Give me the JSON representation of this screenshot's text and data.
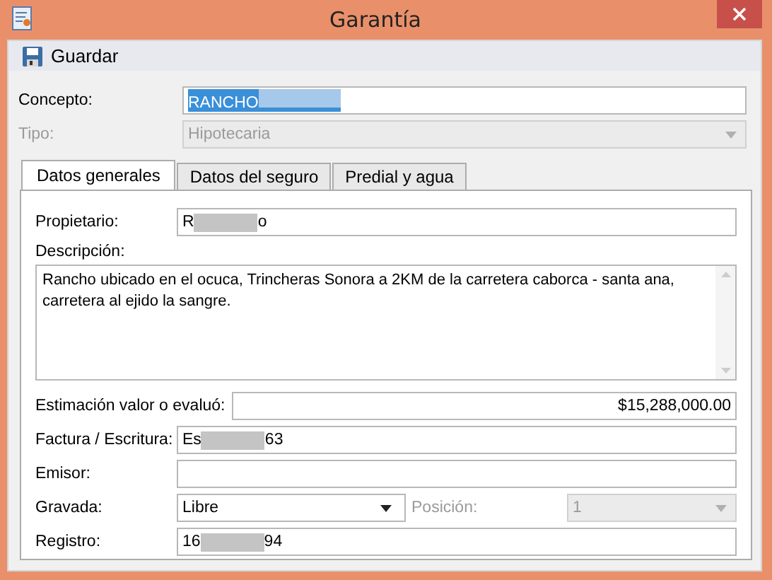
{
  "window": {
    "title": "Garantía"
  },
  "toolbar": [
    {
      "label": "Guardar"
    }
  ],
  "concepto": {
    "label": "Concepto:",
    "value": "RANCHO",
    "redacted": true,
    "selected": true
  },
  "tipo": {
    "label": "Tipo:",
    "value": "Hipotecaria",
    "disabled": true
  },
  "tabs": [
    {
      "label": "Datos generales",
      "selected": true
    },
    {
      "label": "Datos del seguro",
      "selected": false
    },
    {
      "label": "Predial y agua",
      "selected": false
    }
  ],
  "fields": [
    {
      "kind": "text",
      "label": "Propietario:",
      "value": "R",
      "value_end": "o",
      "redacted": true
    },
    {
      "kind": "textarea",
      "label": "Descripción:",
      "value": "Rancho ubicado en el ocuca, Trincheras Sonora a 2KM de la carretera caborca - santa ana, carretera al ejido la sangre."
    },
    {
      "kind": "money",
      "label": "Estimación valor o evaluó:",
      "value": "$15,288,000.00"
    },
    {
      "kind": "text",
      "label": "Factura / Escritura:",
      "value": "Es",
      "value_end": "63",
      "redacted": true
    },
    {
      "kind": "text",
      "label": "Emisor:"
    },
    {
      "kind": "combo",
      "label": "Gravada:",
      "value": "Libre",
      "second": {
        "label": "Posición:",
        "value": "1",
        "disabled": true
      }
    },
    {
      "kind": "text",
      "label": "Registro:",
      "value": "16",
      "value_end": "94",
      "redacted": true
    }
  ]
}
